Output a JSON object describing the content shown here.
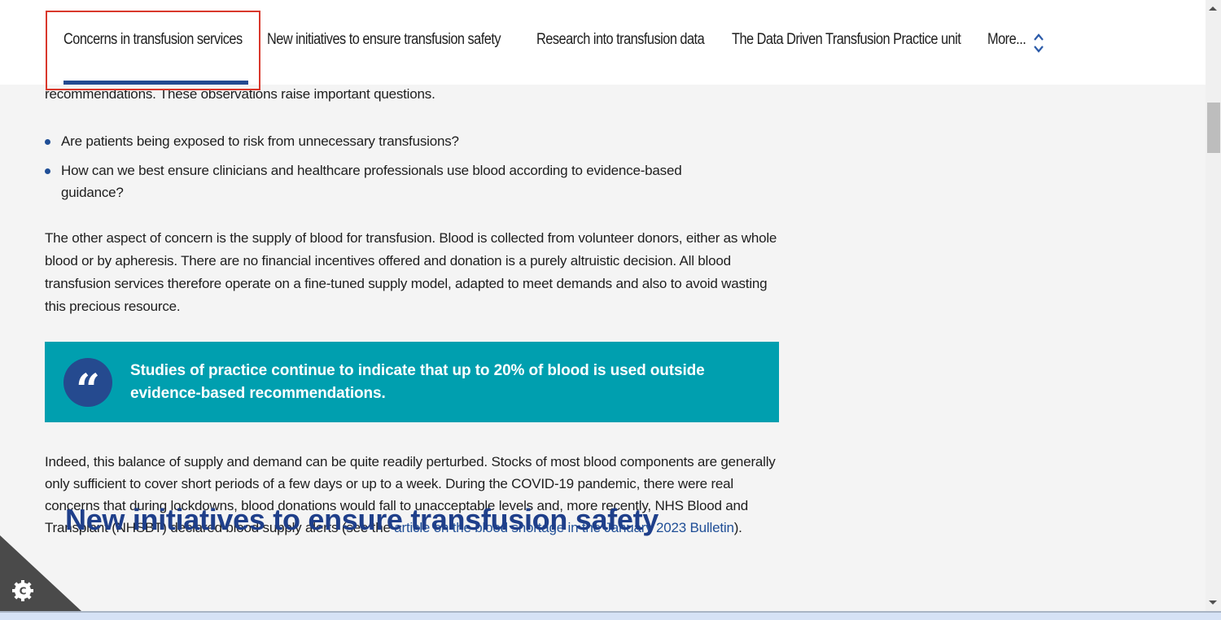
{
  "nav": {
    "items": [
      {
        "label": "Concerns in transfusion services",
        "active": true
      },
      {
        "label": "New initiatives to ensure transfusion safety",
        "active": false
      },
      {
        "label": "Research into transfusion data",
        "active": false
      },
      {
        "label": "The Data Driven Transfusion Practice unit",
        "active": false
      },
      {
        "label": "More...",
        "active": false
      }
    ],
    "more_icon": "chevron-up-down-icon",
    "accent_color": "#234a91",
    "highlight_color": "#d9382c"
  },
  "article": {
    "intro_tail": "recommendations. These observations raise important questions.",
    "bullets": [
      "Are patients being exposed to risk from unnecessary transfusions?",
      "How can we best ensure clinicians and healthcare professionals use blood according to evidence-based guidance?"
    ],
    "paragraph2": "The other aspect of concern is the supply of blood for transfusion. Blood is collected from volunteer donors, either as whole blood or by apheresis. There are no financial incentives offered and donation is a purely altruistic decision. All blood transfusion services therefore operate on a fine-tuned supply model, adapted to meet demands and also to avoid wasting this precious resource.",
    "quote": {
      "icon": "quote-icon",
      "text": "Studies of practice continue to indicate that up to 20% of blood is used outside evidence-based recommendations.",
      "background_color": "#009faf"
    },
    "paragraph3_before_link": "Indeed, this balance of supply and demand can be quite readily perturbed. Stocks of most blood components are generally only sufficient to cover short periods of a few days or up to a week. During the COVID-19 pandemic, there were real concerns that during lockdowns, blood donations would fall to unacceptable levels and, more recently, NHS Blood and Transplant (NHSBT) declared blood supply alerts (see the ",
    "paragraph3_link": "article on the blood shortage in the January 2023 Bulletin",
    "paragraph3_after_link": ").",
    "next_heading": "New initiatives to ensure transfusion safety"
  },
  "cookie_widget": {
    "icon": "cookie-settings-gear-icon",
    "label": "C"
  }
}
